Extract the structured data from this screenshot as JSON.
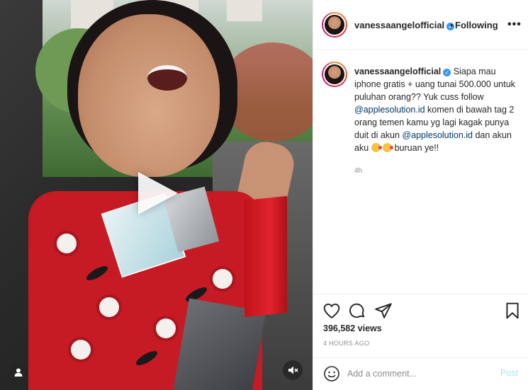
{
  "post": {
    "username": "vanessaangelofficial",
    "follow_status": "Following",
    "more_label": "•••",
    "caption_username": "vanessaangelofficial",
    "caption_part1": "Siapa mau iphone gratis + uang tunai 500.000 untuk puluhan orang?? Yuk cuss follow ",
    "mention1": "@applesolution.id",
    "caption_part2": " komen di bawah tag 2 orang temen kamu yg lagi kagak punya duit di akun ",
    "mention2": "@applesolution.id",
    "caption_part3": " dan akun aku ",
    "caption_part4": " buruan ye!!",
    "caption_time": "4h",
    "views": "396,582 views",
    "posted_ago": "4 HOURS AGO"
  },
  "comment": {
    "placeholder": "Add a comment...",
    "post_label": "Post"
  },
  "icons": {
    "play": "play-icon",
    "user_tag": "user-icon",
    "mute": "speaker-muted-icon",
    "like": "heart-icon",
    "comment": "comment-bubble-icon",
    "share": "paper-plane-icon",
    "save": "bookmark-icon",
    "emoji": "smiley-icon",
    "verified": "verified-badge-icon"
  },
  "colors": {
    "mention": "#00376b",
    "verified": "#3897f0",
    "post_button_disabled": "#b2dffc",
    "muted_text": "#8e8e8e"
  }
}
